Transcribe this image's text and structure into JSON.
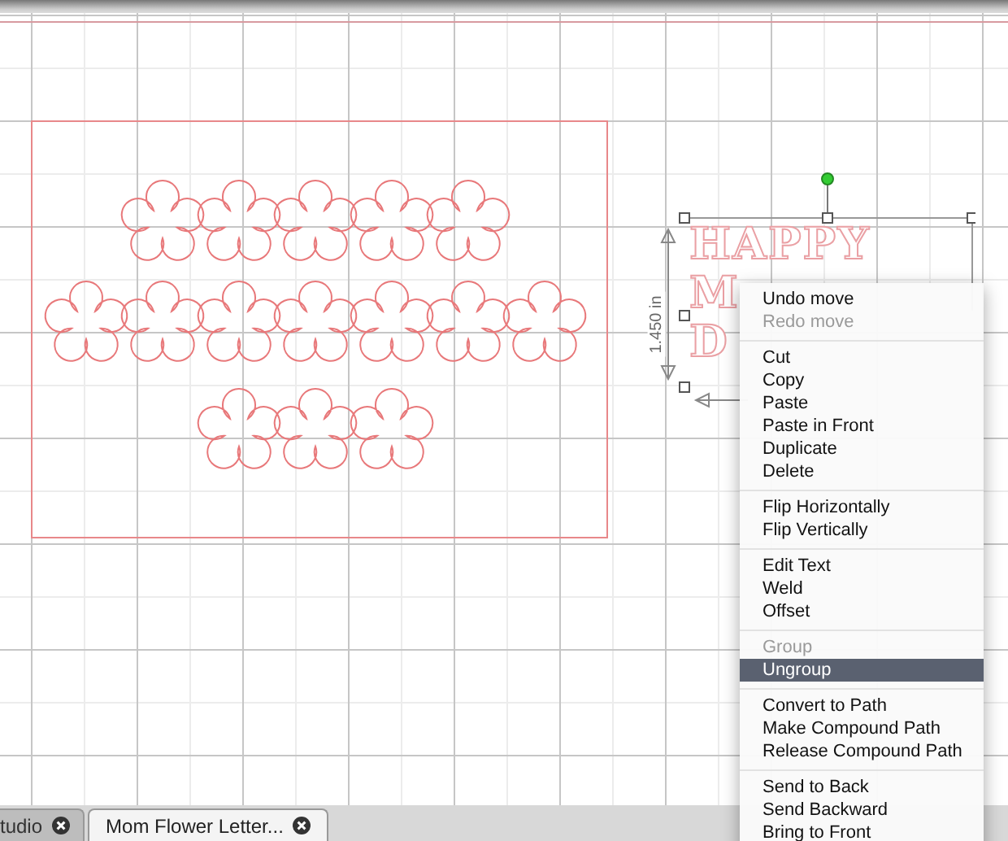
{
  "canvas": {
    "text_lines": [
      "HAPPY",
      "M",
      "D"
    ],
    "dimension": "1.450 in"
  },
  "context_menu": {
    "sections": [
      [
        {
          "label": "Undo move",
          "disabled": false,
          "selected": false
        },
        {
          "label": "Redo move",
          "disabled": true,
          "selected": false
        }
      ],
      [
        {
          "label": "Cut",
          "disabled": false,
          "selected": false
        },
        {
          "label": "Copy",
          "disabled": false,
          "selected": false
        },
        {
          "label": "Paste",
          "disabled": false,
          "selected": false
        },
        {
          "label": "Paste in Front",
          "disabled": false,
          "selected": false
        },
        {
          "label": "Duplicate",
          "disabled": false,
          "selected": false
        },
        {
          "label": "Delete",
          "disabled": false,
          "selected": false
        }
      ],
      [
        {
          "label": "Flip Horizontally",
          "disabled": false,
          "selected": false
        },
        {
          "label": "Flip Vertically",
          "disabled": false,
          "selected": false
        }
      ],
      [
        {
          "label": "Edit Text",
          "disabled": false,
          "selected": false
        },
        {
          "label": "Weld",
          "disabled": false,
          "selected": false
        },
        {
          "label": "Offset",
          "disabled": false,
          "selected": false
        }
      ],
      [
        {
          "label": "Group",
          "disabled": true,
          "selected": false
        },
        {
          "label": "Ungroup",
          "disabled": false,
          "selected": true
        }
      ],
      [
        {
          "label": "Convert to Path",
          "disabled": false,
          "selected": false
        },
        {
          "label": "Make Compound Path",
          "disabled": false,
          "selected": false
        },
        {
          "label": "Release Compound Path",
          "disabled": false,
          "selected": false
        }
      ],
      [
        {
          "label": "Send to Back",
          "disabled": false,
          "selected": false
        },
        {
          "label": "Send Backward",
          "disabled": false,
          "selected": false
        },
        {
          "label": "Bring to Front",
          "disabled": false,
          "selected": false
        }
      ]
    ]
  },
  "tabs": [
    {
      "label": "tudio",
      "selected": false
    },
    {
      "label": "Mom Flower Letter...",
      "selected": true
    }
  ]
}
